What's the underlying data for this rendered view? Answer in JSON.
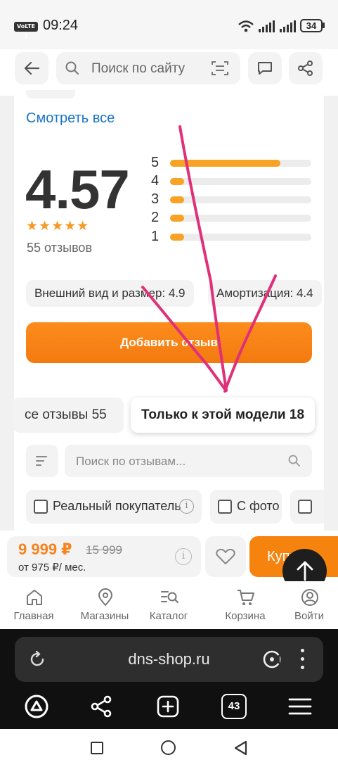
{
  "status_bar": {
    "volte": "VoLTE",
    "sim": "1",
    "time": "09:24",
    "battery": "34"
  },
  "header": {
    "search_placeholder": "Поиск по сайту",
    "icons": [
      "back-arrow-icon",
      "search-icon",
      "scan-icon",
      "chat-icon",
      "share-icon"
    ]
  },
  "reviews": {
    "see_all": "Смотреть все",
    "rating": "4.57",
    "stars": "★★★★★",
    "count_text": "55 отзывов",
    "distribution": [
      {
        "label": "5",
        "fill": 0.78
      },
      {
        "label": "4",
        "fill": 0.1
      },
      {
        "label": "3",
        "fill": 0.1
      },
      {
        "label": "2",
        "fill": 0.1
      },
      {
        "label": "1",
        "fill": 0.1
      }
    ],
    "aspects": [
      "Внешний вид и размер: 4.9",
      "Амортизация: 4.4"
    ],
    "add_button": "Добавить отзыв",
    "tabs": [
      "се отзывы 55",
      "Только к этой модели 18"
    ],
    "search_placeholder": "Поиск по отзывам...",
    "filters": [
      "Реальный покупатель",
      "С фото"
    ]
  },
  "price_bar": {
    "price": "9 999 ₽",
    "old_price": "15 999",
    "monthly": "от 975 ₽/ мес.",
    "buy_label": "Купить"
  },
  "bottom_nav": [
    {
      "label": "Главная",
      "icon": "home-icon"
    },
    {
      "label": "Магазины",
      "icon": "map-pin-icon"
    },
    {
      "label": "Каталог",
      "icon": "catalog-icon"
    },
    {
      "label": "Корзина",
      "icon": "cart-icon"
    },
    {
      "label": "Войти",
      "icon": "user-icon"
    }
  ],
  "browser": {
    "url": "dns-shop.ru",
    "tabs_count": "43"
  },
  "colors": {
    "accent": "#f7830f",
    "link": "#1a73c7",
    "annotation": "#e0307a"
  }
}
